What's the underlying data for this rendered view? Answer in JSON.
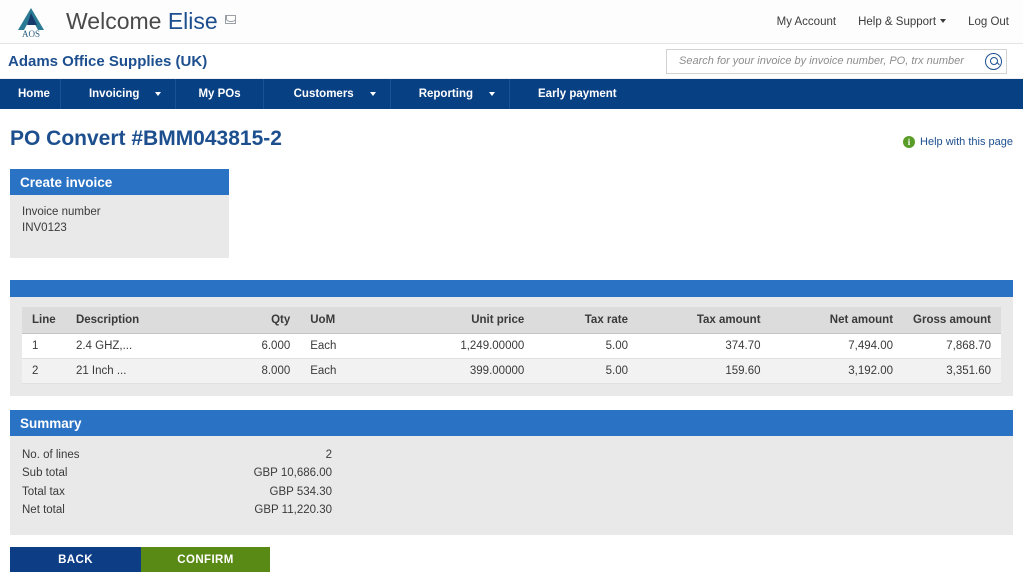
{
  "topbar": {
    "logo_text": "AOS",
    "welcome_prefix": "Welcome ",
    "welcome_user": "Elise",
    "mail_icon": "envelope-icon",
    "links": [
      {
        "label": "My Account",
        "caret": false
      },
      {
        "label": "Help & Support",
        "caret": true
      },
      {
        "label": "Log Out",
        "caret": false
      }
    ]
  },
  "company": {
    "name": "Adams Office Supplies (UK)"
  },
  "search": {
    "placeholder": "Search for your invoice by invoice number, PO, trx number",
    "value": "",
    "icon": "search-icon"
  },
  "nav": {
    "items": [
      {
        "label": "Home",
        "caret": false
      },
      {
        "label": "Invoicing",
        "caret": true
      },
      {
        "label": "My POs",
        "caret": false
      },
      {
        "label": "Customers",
        "caret": true
      },
      {
        "label": "Reporting",
        "caret": true
      },
      {
        "label": "Early payment",
        "caret": false
      }
    ]
  },
  "page": {
    "title": "PO Convert #BMM043815-2",
    "help_label": "Help with this page",
    "help_icon_glyph": "i"
  },
  "create_invoice": {
    "header": "Create invoice",
    "invoice_number_label": "Invoice number",
    "invoice_number_value": "INV0123"
  },
  "lines_table": {
    "headers": [
      "Line",
      "Description",
      "Qty",
      "UoM",
      "Unit price",
      "Tax rate",
      "Tax amount",
      "Net amount",
      "Gross amount"
    ],
    "rows": [
      {
        "line": "1",
        "description": "2.4 GHZ,...",
        "qty": "6.000",
        "uom": "Each",
        "unit_price": "1,249.00000",
        "tax_rate": "5.00",
        "tax_amount": "374.70",
        "net_amount": "7,494.00",
        "gross_amount": "7,868.70"
      },
      {
        "line": "2",
        "description": "21 Inch ...",
        "qty": "8.000",
        "uom": "Each",
        "unit_price": "399.00000",
        "tax_rate": "5.00",
        "tax_amount": "159.60",
        "net_amount": "3,192.00",
        "gross_amount": "3,351.60"
      }
    ]
  },
  "summary": {
    "header": "Summary",
    "rows": [
      {
        "label": "No. of lines",
        "value": "2"
      },
      {
        "label": "Sub total",
        "value": "GBP 10,686.00"
      },
      {
        "label": "Total tax",
        "value": "GBP 534.30"
      },
      {
        "label": "Net total",
        "value": "GBP 11,220.30"
      }
    ]
  },
  "actions": {
    "back_label": "BACK",
    "confirm_label": "CONFIRM"
  },
  "colors": {
    "nav_blue": "#084084",
    "panel_blue": "#2a72c4",
    "title_blue": "#1d4f8f",
    "confirm_green": "#5a8a16",
    "back_blue": "#0d3d84",
    "help_green": "#5a9c28",
    "panel_body_gray": "#e9e9e9"
  }
}
